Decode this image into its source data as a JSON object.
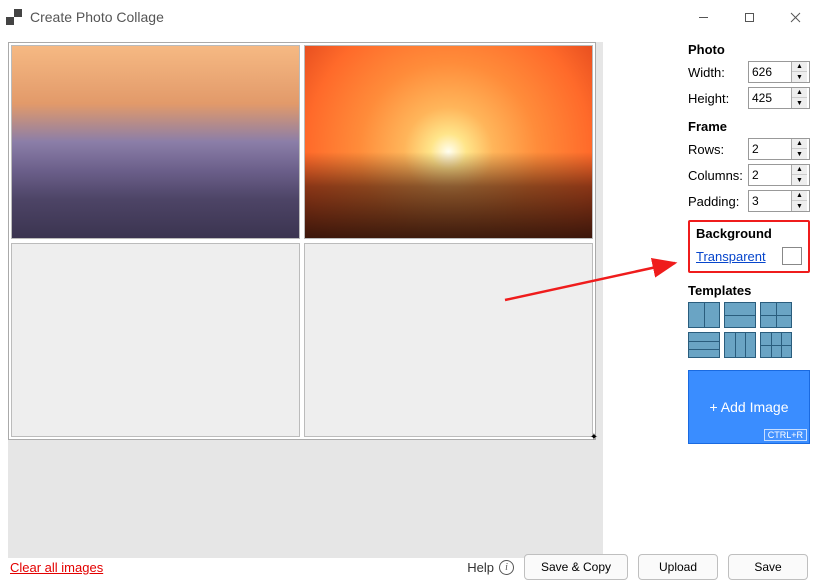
{
  "window": {
    "title": "Create Photo Collage"
  },
  "photo": {
    "section": "Photo",
    "width_label": "Width:",
    "width": "626",
    "height_label": "Height:",
    "height": "425"
  },
  "frame": {
    "section": "Frame",
    "rows_label": "Rows:",
    "rows": "2",
    "columns_label": "Columns:",
    "columns": "2",
    "padding_label": "Padding:",
    "padding": "3"
  },
  "background": {
    "section": "Background",
    "link": "Transparent"
  },
  "templates": {
    "section": "Templates"
  },
  "add_image": {
    "label": "+ Add Image",
    "shortcut": "CTRL+R"
  },
  "footer": {
    "clear": "Clear all images",
    "help": "Help",
    "save_copy": "Save & Copy",
    "upload": "Upload",
    "save": "Save"
  }
}
